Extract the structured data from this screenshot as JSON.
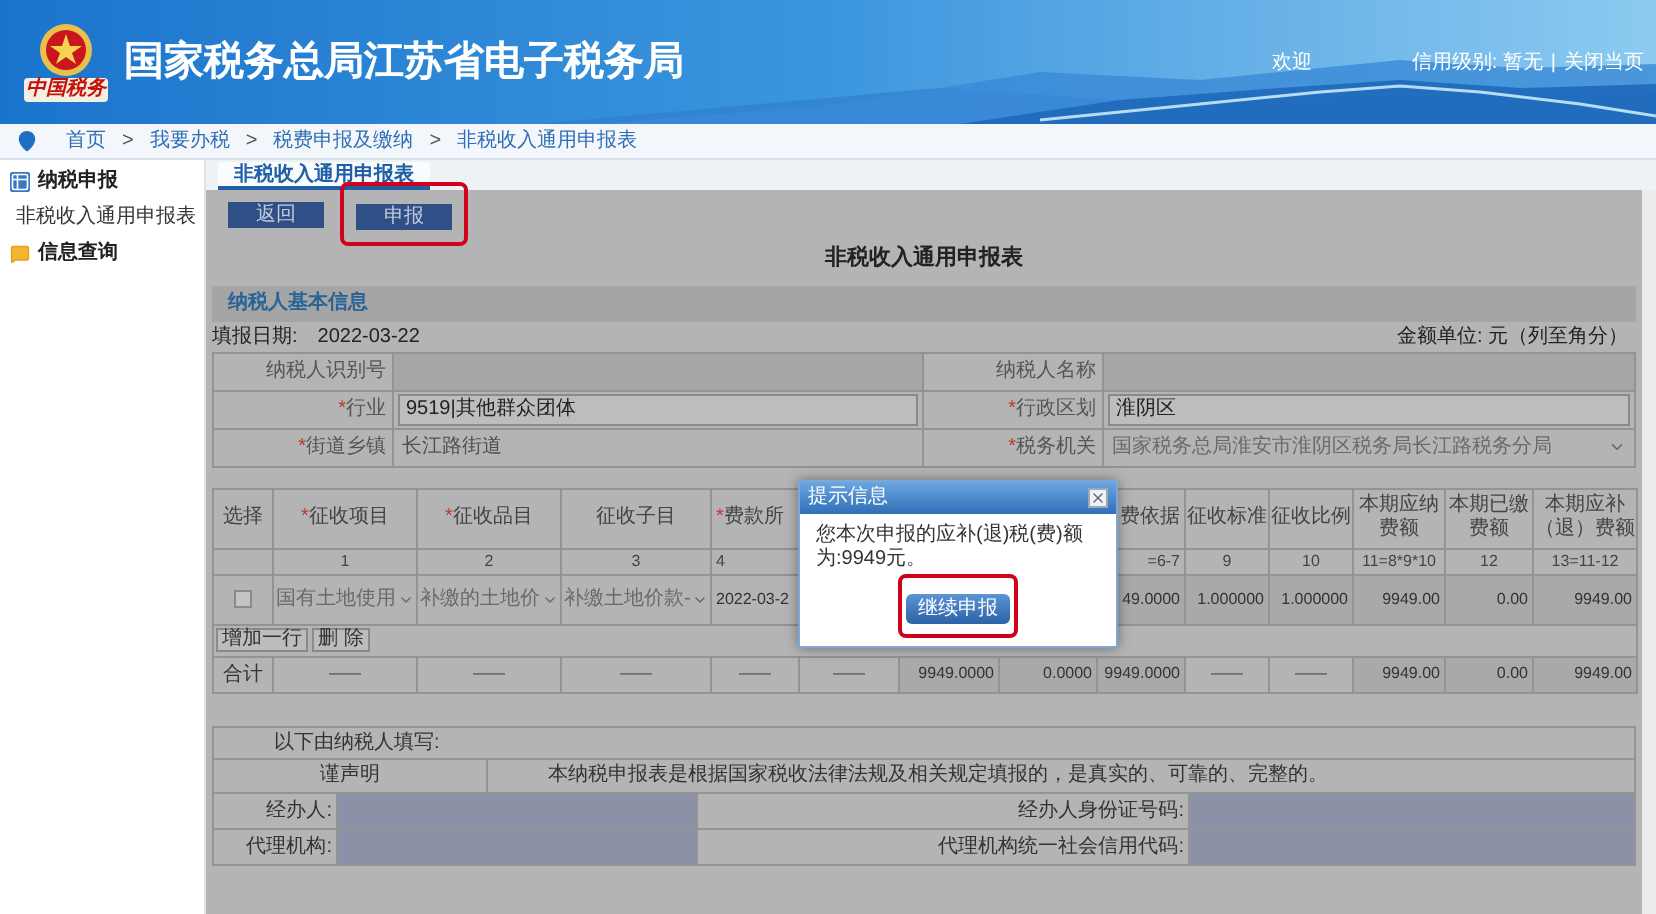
{
  "header": {
    "logo_text": "中国税务",
    "title": "国家税务总局江苏省电子税务局",
    "welcome": "欢迎",
    "credit": "信用级别: 暂无",
    "divider": "|",
    "close_link": "关闭当页"
  },
  "breadcrumb": {
    "items": [
      "首页",
      "我要办税",
      "税费申报及缴纳",
      "非税收入通用申报表"
    ],
    "separator": ">"
  },
  "sidebar": {
    "items": [
      {
        "label": "纳税申报",
        "children": [
          {
            "label": "非税收入通用申报表"
          }
        ]
      },
      {
        "label": "信息查询"
      }
    ]
  },
  "tabs": [
    {
      "label": "非税收入通用申报表",
      "selected": true
    }
  ],
  "required_mark": "*",
  "toolbar": [
    {
      "label": "返回",
      "highlighted": false
    },
    {
      "label": "申报",
      "highlighted": true
    }
  ],
  "form_title": "非税收入通用申报表",
  "section_title": "纳税人基本信息",
  "fill_date": {
    "label": "填报日期:",
    "value": "2022-03-22"
  },
  "amount_unit": "金额单位: 元（列至角分）",
  "taxpayer_fields": [
    [
      {
        "label": "纳税人识别号",
        "required": false,
        "kind": "readonly"
      },
      {
        "label": "纳税人名称",
        "required": false,
        "kind": "readonly"
      }
    ],
    [
      {
        "label": "行业",
        "required": true,
        "kind": "input",
        "value": "9519|其他群众团体"
      },
      {
        "label": "行政区划",
        "required": true,
        "kind": "input",
        "value": "淮阴区"
      }
    ],
    [
      {
        "label": "街道乡镇",
        "required": true,
        "kind": "static",
        "value": "长江路街道"
      },
      {
        "label": "税务机关",
        "required": true,
        "kind": "select",
        "value": "国家税务总局淮安市淮阴区税务局长江路税务分局"
      }
    ]
  ],
  "table": {
    "columns": [
      {
        "label": "选择",
        "required": false
      },
      {
        "label": "征收项目",
        "required": true,
        "index": "1"
      },
      {
        "label": "征收品目",
        "required": true,
        "index": "2"
      },
      {
        "label": "征收子目",
        "required": false,
        "index": "3"
      },
      {
        "label": "费款所",
        "required": true,
        "index": "4"
      },
      null,
      null,
      null,
      {
        "label": "费依据",
        "required": false,
        "index": "=6-7"
      },
      {
        "label": "征收标准",
        "required": false,
        "index": "9"
      },
      {
        "label": "征收比例",
        "required": false,
        "index": "10"
      },
      {
        "label": "本期应纳费额",
        "required": false,
        "index": "11=8*9*10"
      },
      {
        "label": "本期已缴费额",
        "required": false,
        "index": "12"
      },
      {
        "label": "本期应补（退）费额",
        "required": false,
        "index": "13=11-12"
      }
    ],
    "rows": [
      {
        "cells": [
          {
            "kind": "checkbox",
            "checked": false
          },
          {
            "kind": "select",
            "text": "国有土地使用"
          },
          {
            "kind": "select",
            "text": "补缴的土地价"
          },
          {
            "kind": "select",
            "text": "补缴土地价款-"
          },
          {
            "kind": "text",
            "text": "2022-03-2"
          },
          null,
          null,
          null,
          {
            "kind": "number",
            "text": "49.0000"
          },
          {
            "kind": "number",
            "text": "1.000000"
          },
          {
            "kind": "number",
            "text": "1.000000"
          },
          {
            "kind": "number",
            "text": "9949.00"
          },
          {
            "kind": "number",
            "text": "0.00"
          },
          {
            "kind": "number",
            "text": "9949.00"
          }
        ]
      }
    ],
    "actions": [
      "增加一行",
      "删 除"
    ],
    "total_row": [
      "合计",
      "——",
      "——",
      "——",
      "——",
      "——",
      "9949.0000",
      "0.0000",
      "9949.0000",
      "——",
      "——",
      "9949.00",
      "0.00",
      "9949.00"
    ]
  },
  "modal": {
    "title": "提示信息",
    "message": "您本次申报的应补(退)税(费)额为:9949元。",
    "button": {
      "label": "继续申报",
      "highlighted": true
    }
  },
  "declaration": {
    "intro": "以下由纳税人填写:",
    "label": "谨声明",
    "text": "本纳税申报表是根据国家税收法律法规及相关规定填报的，是真实的、可靠的、完整的。"
  },
  "signers": [
    [
      {
        "label": "经办人:"
      },
      {
        "label": "经办人身份证号码:"
      }
    ],
    [
      {
        "label": "代理机构:"
      },
      {
        "label": "代理机构统一社会信用代码:"
      }
    ]
  ]
}
